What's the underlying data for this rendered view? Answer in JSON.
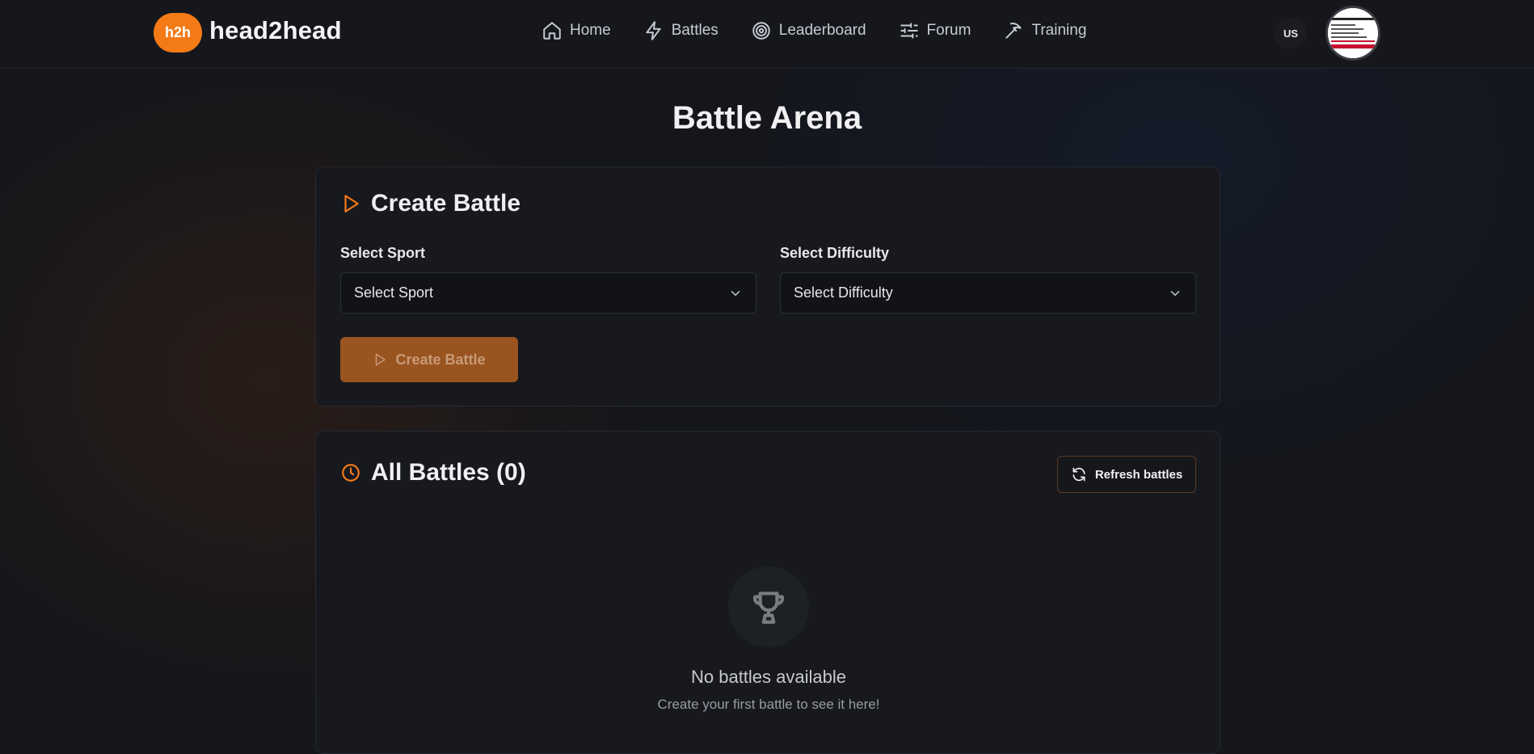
{
  "brand": {
    "badge": "h2h",
    "name": "head2head",
    "accent": "#f47a16"
  },
  "nav": {
    "items": [
      {
        "label": "Home",
        "icon": "home-icon"
      },
      {
        "label": "Battles",
        "icon": "lightning-icon"
      },
      {
        "label": "Leaderboard",
        "icon": "target-icon"
      },
      {
        "label": "Forum",
        "icon": "sliders-icon"
      },
      {
        "label": "Training",
        "icon": "pickaxe-icon"
      }
    ]
  },
  "header": {
    "language": "US",
    "avatar_icon": "avatar-image"
  },
  "page": {
    "title": "Battle Arena"
  },
  "create_battle": {
    "title": "Create Battle",
    "icon": "play-icon",
    "sport_label": "Select Sport",
    "sport_value": "Select Sport",
    "difficulty_label": "Select Difficulty",
    "difficulty_value": "Select Difficulty",
    "button_label": "Create Battle"
  },
  "all_battles": {
    "title": "All Battles (0)",
    "icon": "clock-icon",
    "refresh_label": "Refresh battles",
    "empty_icon": "trophy-icon",
    "empty_title": "No battles available",
    "empty_subtitle": "Create your first battle to see it here!"
  }
}
